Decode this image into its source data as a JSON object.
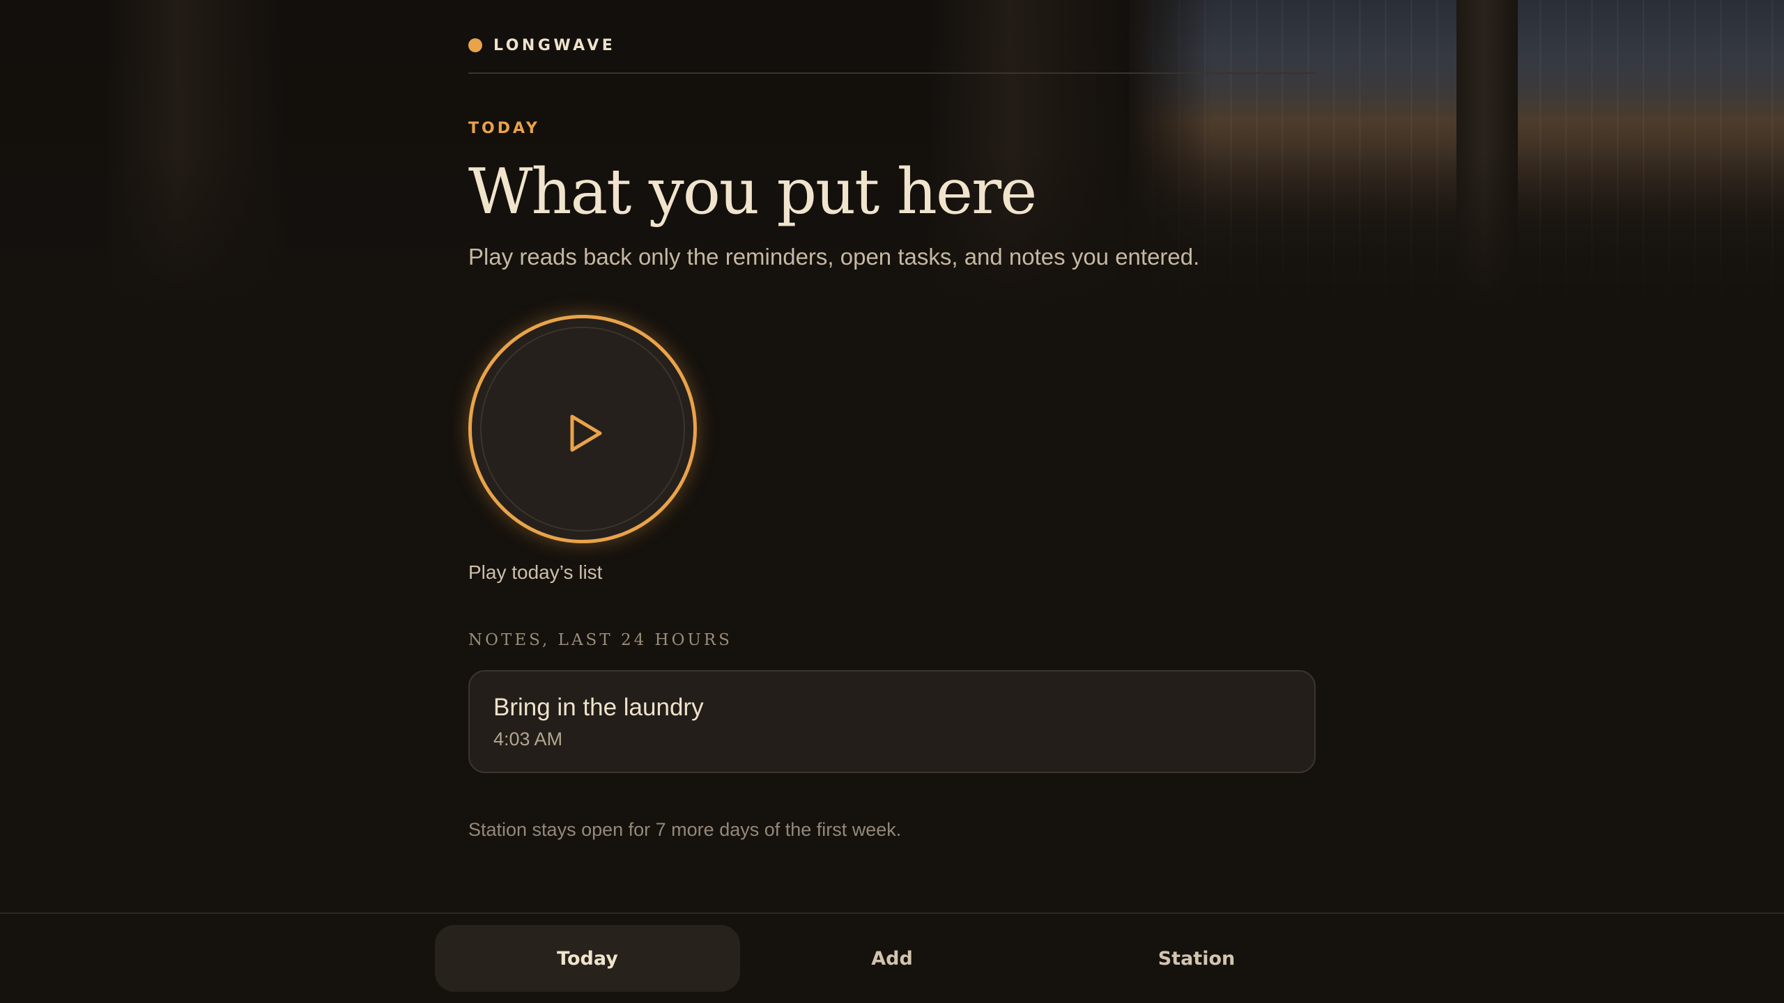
{
  "brand": {
    "name": "LONGWAVE",
    "accent_color": "#e9a34a"
  },
  "header": {
    "eyebrow": "TODAY",
    "title": "What you put here",
    "subtitle": "Play reads back only the reminders, open tasks, and notes you entered."
  },
  "player": {
    "icon": "play-icon",
    "caption": "Play today’s list"
  },
  "notes": {
    "section_label": "NOTES, LAST 24 HOURS",
    "items": [
      {
        "title": "Bring in the laundry",
        "time": "4:03 AM"
      }
    ]
  },
  "footnote": "Station stays open for 7 more days of the first week.",
  "tabbar": {
    "active": "Today",
    "tabs": [
      {
        "label": "Today"
      },
      {
        "label": "Add"
      },
      {
        "label": "Station"
      }
    ]
  }
}
